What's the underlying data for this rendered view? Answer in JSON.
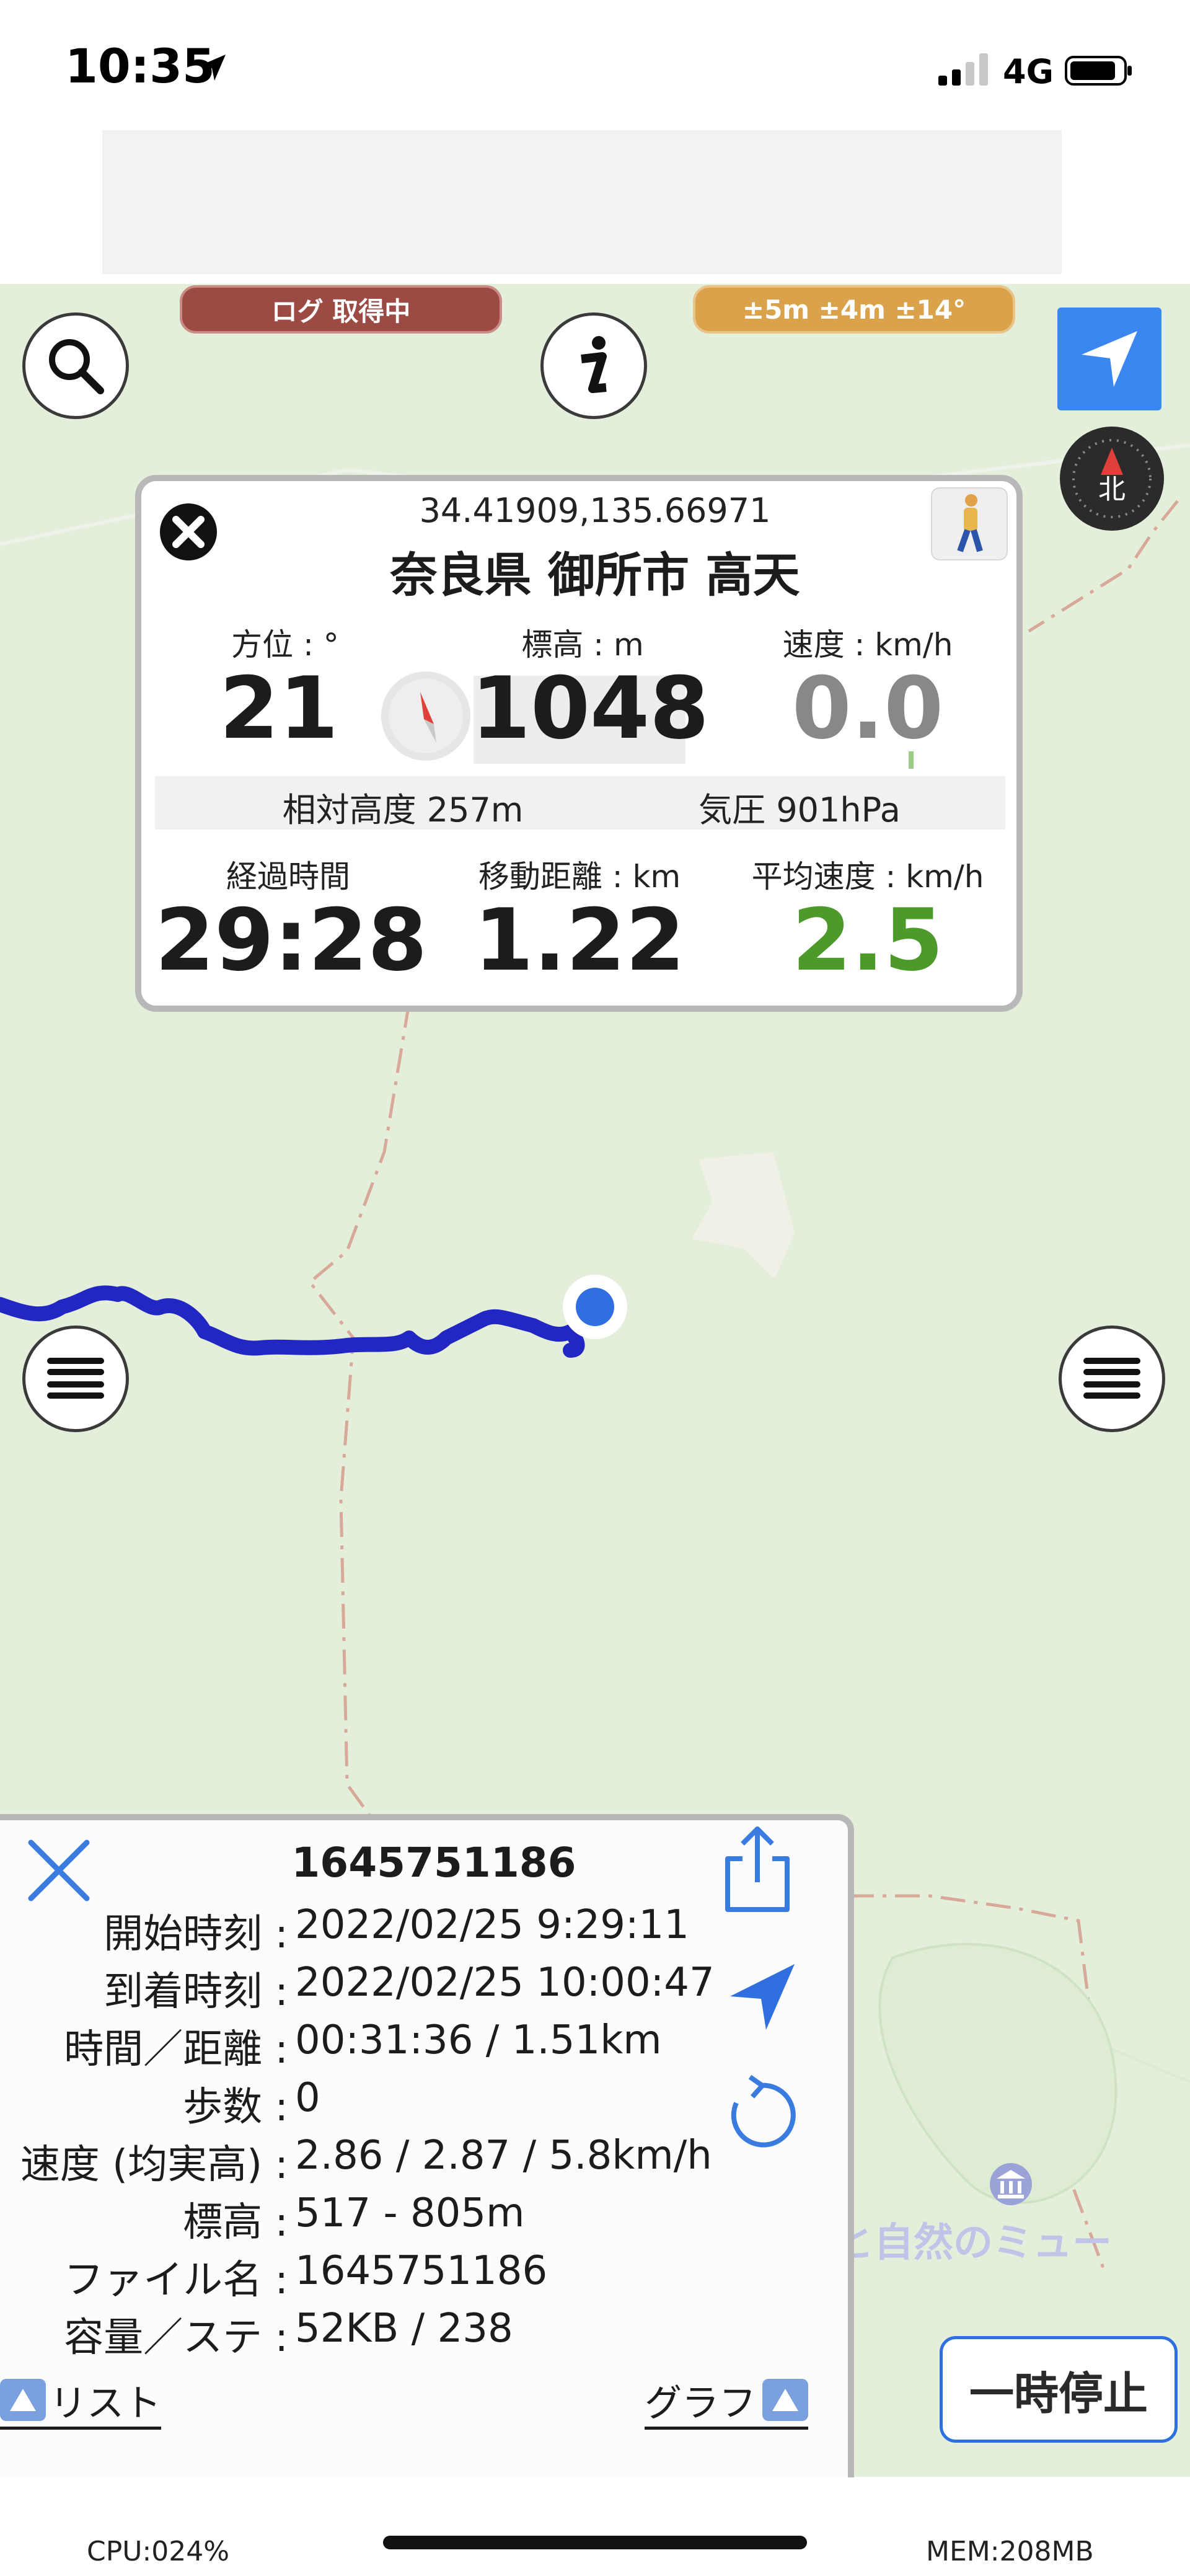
{
  "status_bar": {
    "time": "10:35",
    "network": "4G",
    "icons": [
      "location-arrow-icon",
      "signal-bars-icon",
      "battery-icon"
    ]
  },
  "map_overlay": {
    "log_status": "ログ 取得中",
    "accuracy": "±5m ±4m ±14°",
    "buttons": [
      "search-icon",
      "info-icon",
      "locate-icon",
      "compass-icon",
      "menu-icon"
    ],
    "compass_label": "北",
    "track_color": "#2227c4",
    "position_color": "#2f6fe0"
  },
  "info_panel": {
    "coords": "34.41909,135.66971",
    "address": "奈良県 御所市 高天",
    "bearing": {
      "label": "方位 : °",
      "value": "21"
    },
    "elevation": {
      "label": "標高 : m",
      "value": "1048"
    },
    "speed": {
      "label": "速度 : km/h",
      "value": "0.0"
    },
    "relative_alt": "相対高度 257m",
    "pressure": "気圧 901hPa",
    "elapsed": {
      "label": "経過時間",
      "value": "29:28"
    },
    "distance": {
      "label": "移動距離 : km",
      "value": "1.22"
    },
    "avg_speed": {
      "label": "平均速度 : km/h",
      "value": "2.5"
    }
  },
  "track_panel": {
    "title": "1645751186",
    "rows": [
      {
        "key": "開始時刻 :",
        "value": "2022/02/25 9:29:11"
      },
      {
        "key": "到着時刻 :",
        "value": "2022/02/25 10:00:47"
      },
      {
        "key": "時間／距離 :",
        "value": "00:31:36 / 1.51km"
      },
      {
        "key": "歩数 :",
        "value": "0"
      },
      {
        "key": "速度 (均実高) :",
        "value": "2.86 / 2.87 / 5.8km/h"
      },
      {
        "key": "標高 :",
        "value": "517 - 805m"
      },
      {
        "key": "ファイル名 :",
        "value": "1645751186"
      },
      {
        "key": "容量／ステ :",
        "value": "52KB / 238"
      }
    ],
    "list_label": "リスト",
    "graph_label": "グラフ"
  },
  "pause_label": "一時停止",
  "map_label": "ちはや星と自然のミュー",
  "bottom": {
    "cpu": "CPU:024%",
    "mem": "MEM:208MB"
  }
}
